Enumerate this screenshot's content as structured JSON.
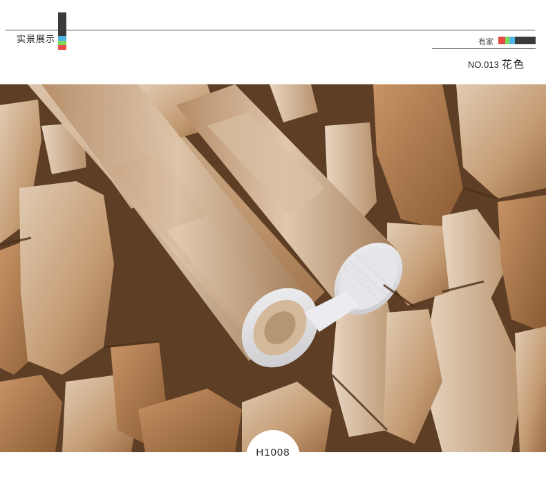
{
  "header": {
    "section_title": "实景展示",
    "left_bar_colors": [
      "#3a3a3a",
      "#3a3a3a",
      "#4fb3e0",
      "#7ed957",
      "#e84a4a"
    ],
    "brand_label": "有家",
    "swatch_colors": [
      "#e84a4a",
      "#7ed957",
      "#4fb3e0",
      "#3a3a3a"
    ],
    "product_no": "NO.013",
    "color_name": "花色"
  },
  "photo": {
    "description_icon": "stone-wallpaper-photo",
    "badge_text": "H1008"
  },
  "colors": {
    "stone_light": "#d8bfa4",
    "stone_mid": "#b88a60",
    "stone_dark": "#8a5e38",
    "gap": "#5a3b22"
  }
}
